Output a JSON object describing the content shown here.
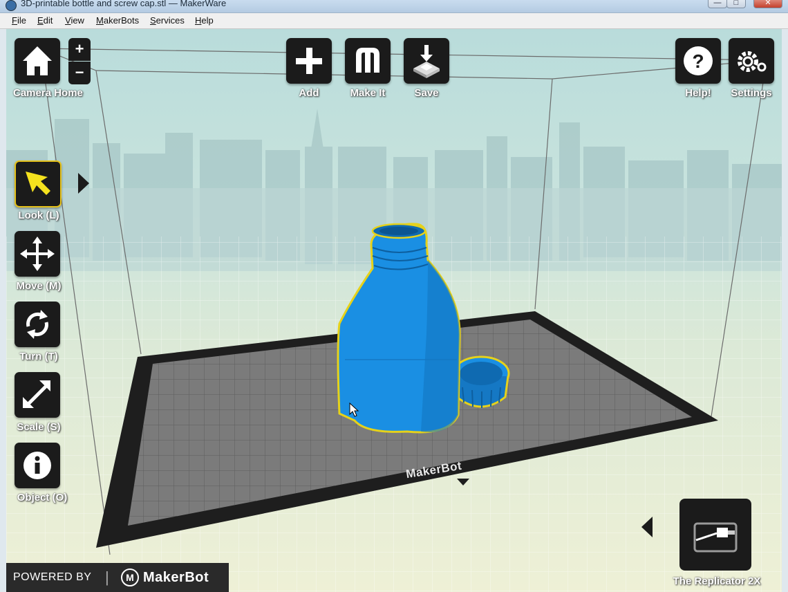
{
  "window": {
    "title": "3D-printable bottle and screw cap.stl — MakerWare",
    "controls": {
      "minimize": "—",
      "maximize": "□",
      "close": "✕"
    }
  },
  "menu": {
    "items": [
      {
        "accel": "F",
        "rest": "ile"
      },
      {
        "accel": "E",
        "rest": "dit"
      },
      {
        "accel": "V",
        "rest": "iew"
      },
      {
        "accel": "M",
        "rest": "akerBots"
      },
      {
        "accel": "S",
        "rest": "ervices"
      },
      {
        "accel": "H",
        "rest": "elp"
      }
    ]
  },
  "toolbar": {
    "camera_home": "Camera Home",
    "zoom_in": "+",
    "zoom_out": "−",
    "add": "Add",
    "make_it": "Make It",
    "save": "Save",
    "help": "Help!",
    "settings": "Settings"
  },
  "tools": {
    "look": "Look (L)",
    "move": "Move (M)",
    "turn": "Turn (T)",
    "scale": "Scale (S)",
    "object": "Object (O)"
  },
  "build_plate": {
    "brand": "MakerBot"
  },
  "printer": {
    "name": "The Replicator 2X"
  },
  "footer": {
    "powered_by": "POWERED BY",
    "separator": "|",
    "brand": "MakerBot",
    "logo_letter": "M"
  },
  "colors": {
    "model": "#1a8fe3",
    "selection_outline": "#e6d21a",
    "button_bg": "#1b1b1b",
    "plate": "#7b7b7b",
    "plate_border": "#1e1e1e"
  },
  "icons": {
    "camera_home": "home-icon",
    "add": "plus-icon",
    "make_it": "makerbot-m-icon",
    "save": "save-print-icon",
    "help": "question-icon",
    "settings": "gear-icon",
    "look": "pointer-arrow-icon",
    "move": "move-arrows-icon",
    "turn": "rotate-icon",
    "scale": "scale-arrow-icon",
    "object": "info-icon",
    "printer": "usb-printer-icon"
  }
}
